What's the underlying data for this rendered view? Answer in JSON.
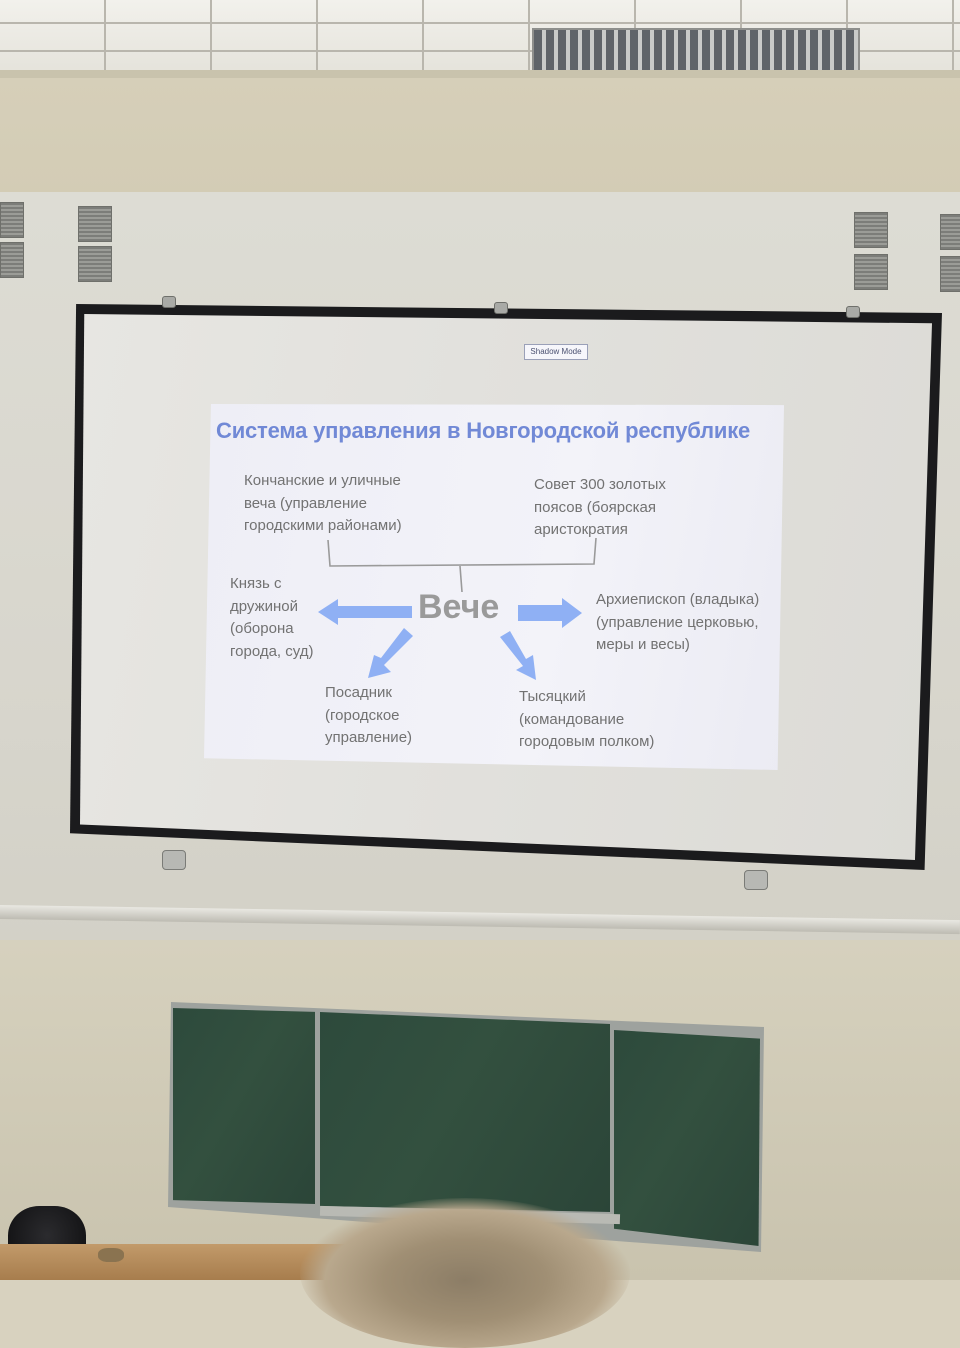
{
  "projector_overlay": {
    "label": "Shadow Mode"
  },
  "slide": {
    "title": "Система управления в Новгородской республике",
    "center": "Вече",
    "konchanskie": "Кончанские и уличные\nвеча (управление\nгородскими районами)",
    "sovet": "Совет 300 золотых\nпоясов (боярская\nаристократия",
    "knyaz": "Князь с\nдружиной\n(оборона\nгорода, суд)",
    "arkhiepiskop": "Архиепископ (владыка)\n(управление церковью,\nмеры и весы)",
    "posadnik": "Посадник\n(городское\nуправление)",
    "tysyatsky": "Тысяцкий\n(командование\nгородовым полком)"
  },
  "colors": {
    "title": "#7189d6",
    "arrow": "#8fb0f4",
    "body_text": "#727272",
    "chalkboard": "#2f4c3d"
  }
}
